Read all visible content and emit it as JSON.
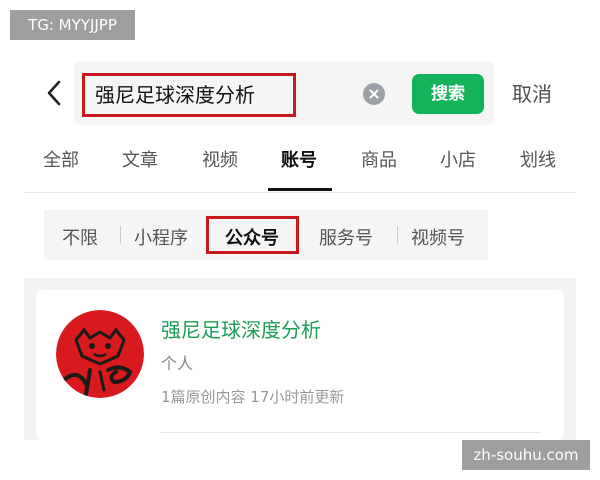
{
  "watermarks": {
    "top_left": "TG: MYYJJPP",
    "bottom_right": "zh-souhu.com"
  },
  "search": {
    "query": "强尼足球深度分析",
    "search_label": "搜索",
    "cancel_label": "取消"
  },
  "tabs": [
    {
      "label": "全部",
      "active": false
    },
    {
      "label": "文章",
      "active": false
    },
    {
      "label": "视频",
      "active": false
    },
    {
      "label": "账号",
      "active": true
    },
    {
      "label": "商品",
      "active": false
    },
    {
      "label": "小店",
      "active": false
    },
    {
      "label": "划线",
      "active": false
    }
  ],
  "filters": [
    {
      "label": "不限",
      "active": false
    },
    {
      "label": "小程序",
      "active": false
    },
    {
      "label": "公众号",
      "active": true
    },
    {
      "label": "服务号",
      "active": false
    },
    {
      "label": "视频号",
      "active": false
    }
  ],
  "result": {
    "name": "强尼足球深度分析",
    "type": "个人",
    "meta": "1篇原创内容  17小时前更新"
  },
  "colors": {
    "accent_green": "#14b35a",
    "highlight_red": "#c8181b",
    "name_green": "#1a9e54"
  },
  "icons": {
    "back": "chevron-left-icon",
    "clear": "clear-circle-icon"
  }
}
